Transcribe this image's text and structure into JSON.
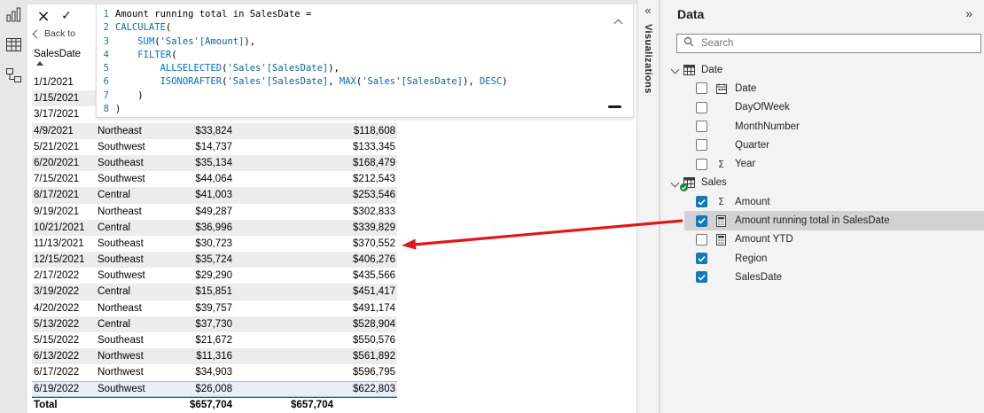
{
  "left_nav": {
    "items": [
      {
        "name": "report-view"
      },
      {
        "name": "data-view"
      },
      {
        "name": "model-view"
      }
    ]
  },
  "formula_bar": {
    "cancel_glyph": "×",
    "commit_glyph": "✓",
    "back_label": "Back to",
    "lines": [
      {
        "n": "1",
        "tokens": [
          {
            "c": "plain",
            "t": "Amount running total in SalesDate = "
          }
        ]
      },
      {
        "n": "2",
        "tokens": [
          {
            "c": "fn",
            "t": "CALCULATE"
          },
          {
            "c": "plain",
            "t": "("
          }
        ]
      },
      {
        "n": "3",
        "tokens": [
          {
            "c": "plain",
            "t": "    "
          },
          {
            "c": "fn",
            "t": "SUM"
          },
          {
            "c": "plain",
            "t": "("
          },
          {
            "c": "ref",
            "t": "'Sales'[Amount]"
          },
          {
            "c": "plain",
            "t": "),"
          }
        ]
      },
      {
        "n": "4",
        "tokens": [
          {
            "c": "plain",
            "t": "    "
          },
          {
            "c": "fn",
            "t": "FILTER"
          },
          {
            "c": "plain",
            "t": "("
          }
        ]
      },
      {
        "n": "5",
        "tokens": [
          {
            "c": "plain",
            "t": "        "
          },
          {
            "c": "fn",
            "t": "ALLSELECTED"
          },
          {
            "c": "plain",
            "t": "("
          },
          {
            "c": "ref",
            "t": "'Sales'[SalesDate]"
          },
          {
            "c": "plain",
            "t": "),"
          }
        ]
      },
      {
        "n": "6",
        "tokens": [
          {
            "c": "plain",
            "t": "        "
          },
          {
            "c": "fn",
            "t": "ISONORAFTER"
          },
          {
            "c": "plain",
            "t": "("
          },
          {
            "c": "ref",
            "t": "'Sales'[SalesDate]"
          },
          {
            "c": "plain",
            "t": ", "
          },
          {
            "c": "fn",
            "t": "MAX"
          },
          {
            "c": "plain",
            "t": "("
          },
          {
            "c": "ref",
            "t": "'Sales'[SalesDate]"
          },
          {
            "c": "plain",
            "t": ")"
          },
          {
            "c": "plain",
            "t": ", "
          },
          {
            "c": "kw",
            "t": "DESC"
          },
          {
            "c": "plain",
            "t": ")"
          }
        ]
      },
      {
        "n": "7",
        "tokens": [
          {
            "c": "plain",
            "t": "    )"
          }
        ]
      },
      {
        "n": "8",
        "tokens": [
          {
            "c": "plain",
            "t": ")"
          }
        ]
      }
    ]
  },
  "table": {
    "header": "SalesDate",
    "sort": "ascending",
    "partial_rows": [
      "1/1/2021",
      "1/15/2021",
      "3/17/2021"
    ],
    "rows": [
      [
        "4/9/2021",
        "Northeast",
        "$33,824",
        "$118,608"
      ],
      [
        "5/21/2021",
        "Southwest",
        "$14,737",
        "$133,345"
      ],
      [
        "6/20/2021",
        "Southeast",
        "$35,134",
        "$168,479"
      ],
      [
        "7/15/2021",
        "Southwest",
        "$44,064",
        "$212,543"
      ],
      [
        "8/17/2021",
        "Central",
        "$41,003",
        "$253,546"
      ],
      [
        "9/19/2021",
        "Northeast",
        "$49,287",
        "$302,833"
      ],
      [
        "10/21/2021",
        "Central",
        "$36,996",
        "$339,829"
      ],
      [
        "11/13/2021",
        "Southeast",
        "$30,723",
        "$370,552"
      ],
      [
        "12/15/2021",
        "Southeast",
        "$35,724",
        "$406,276"
      ],
      [
        "2/17/2022",
        "Southwest",
        "$29,290",
        "$435,566"
      ],
      [
        "3/19/2022",
        "Central",
        "$15,851",
        "$451,417"
      ],
      [
        "4/20/2022",
        "Northeast",
        "$39,757",
        "$491,174"
      ],
      [
        "5/13/2022",
        "Central",
        "$37,730",
        "$528,904"
      ],
      [
        "5/15/2022",
        "Southeast",
        "$21,672",
        "$550,576"
      ],
      [
        "6/13/2022",
        "Northwest",
        "$11,316",
        "$561,892"
      ],
      [
        "6/17/2022",
        "Northwest",
        "$34,903",
        "$596,795"
      ],
      [
        "6/19/2022",
        "Southwest",
        "$26,008",
        "$622,803"
      ]
    ],
    "selected_row_date": "6/19/2022",
    "total": {
      "label": "Total",
      "amount": "$657,704",
      "running_total": "$657,704"
    }
  },
  "visualizations_pane": {
    "title": "Visualizations",
    "collapse_glyph": "«"
  },
  "data_pane": {
    "title": "Data",
    "expand_glyph": "»",
    "search_placeholder": "Search",
    "tables": [
      {
        "name": "Date",
        "expanded": true,
        "badge": null,
        "fields": [
          {
            "label": "Date",
            "icon": "calendar",
            "checked": false
          },
          {
            "label": "DayOfWeek",
            "icon": null,
            "checked": false
          },
          {
            "label": "MonthNumber",
            "icon": null,
            "checked": false
          },
          {
            "label": "Quarter",
            "icon": null,
            "checked": false
          },
          {
            "label": "Year",
            "icon": "sigma",
            "checked": false
          }
        ]
      },
      {
        "name": "Sales",
        "expanded": true,
        "badge": "green-check",
        "fields": [
          {
            "label": "Amount",
            "icon": "sigma",
            "checked": true
          },
          {
            "label": "Amount running total in SalesDate",
            "icon": "measure",
            "checked": true,
            "selected": true
          },
          {
            "label": "Amount YTD",
            "icon": "measure",
            "checked": false
          },
          {
            "label": "Region",
            "icon": null,
            "checked": true
          },
          {
            "label": "SalesDate",
            "icon": null,
            "checked": true
          }
        ]
      }
    ]
  },
  "annotation": {
    "arrow_color": "#E21717",
    "from": "field: Amount running total in SalesDate",
    "to": "table value: $370,552"
  },
  "colors": {
    "checkbox_accent": "#0F7CBA",
    "selected_field_bg": "#D2D2D2",
    "code_function": "#0070C0",
    "code_reference": "#0B61A4",
    "line_number": "#237893"
  }
}
